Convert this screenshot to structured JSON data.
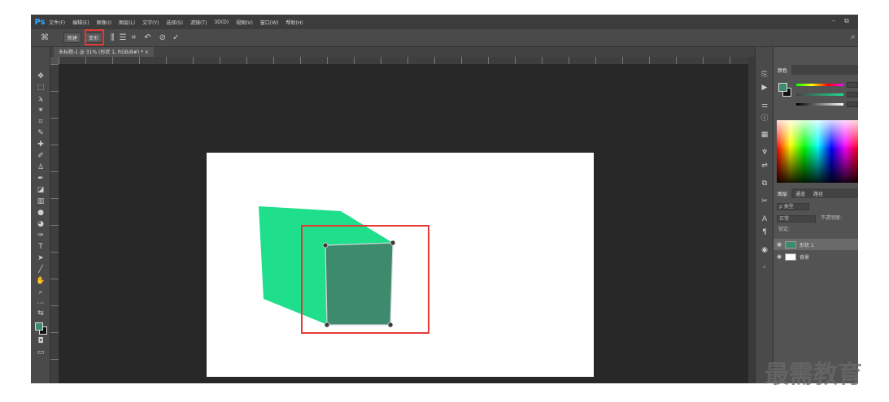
{
  "app": {
    "logo": "Ps",
    "menu": [
      "文件(F)",
      "编辑(E)",
      "图像(I)",
      "图层(L)",
      "文字(Y)",
      "选择(S)",
      "滤镜(T)",
      "3D(D)",
      "视图(V)",
      "窗口(W)",
      "帮助(H)"
    ]
  },
  "options_bar": {
    "btn_1": "新建",
    "btn_2": "变形",
    "icons": [
      "align-icon",
      "distribute-icon",
      "grid-icon",
      "undo-warp-icon",
      "cancel-icon",
      "commit-icon"
    ]
  },
  "document": {
    "tab_title": "未标题-1 @ 31% (形状 1, RGB/8#) *",
    "tab_close": "×"
  },
  "colors": {
    "foreground": "#3d8a6d",
    "background": "#111111",
    "box_face_front": "#3d8a6d",
    "box_face_side": "#1fde8c",
    "highlight": "#e53935"
  },
  "panels": {
    "color_tab": "颜色",
    "layers_tabs": [
      "图层",
      "通道",
      "路径"
    ],
    "search_placeholder": "ρ 类型",
    "blend_mode": "正常",
    "opacity_label": "不透明度:",
    "lock_label": "锁定:",
    "layers": [
      {
        "name": "形状 1",
        "selected": true
      },
      {
        "name": "背景",
        "selected": false
      }
    ]
  },
  "watermark": "最需教育"
}
